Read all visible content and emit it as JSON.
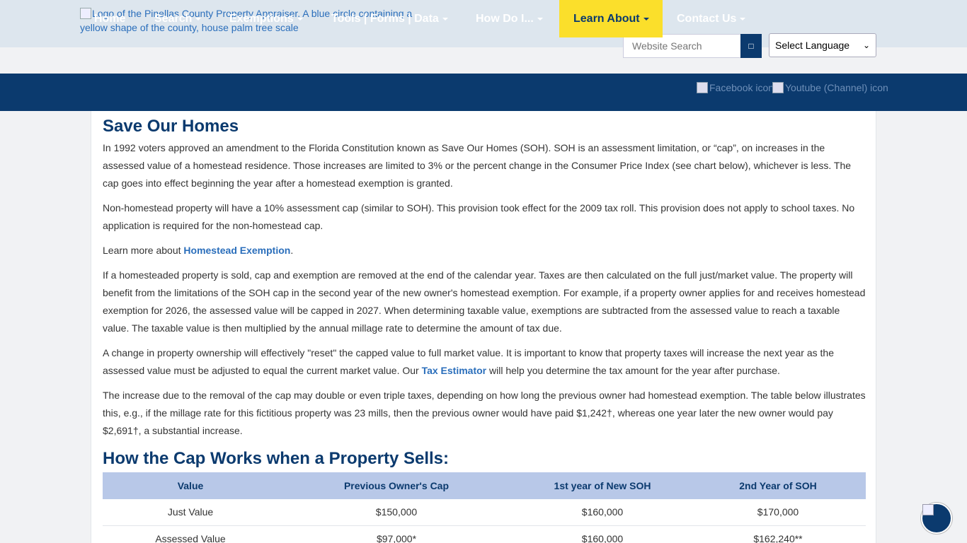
{
  "header": {
    "logo_alt": "Logo of the Pinellas County Property Appraiser. A blue circle containing a yellow shape of the county, house palm tree scale",
    "search_placeholder": "Website Search",
    "language_select": "Select Language"
  },
  "nav": {
    "items": [
      {
        "label": "Home",
        "dropdown": false
      },
      {
        "label": "Search",
        "dropdown": true
      },
      {
        "label": "Exemptions",
        "dropdown": true
      },
      {
        "label": "Tools | Forms | Data",
        "dropdown": true
      },
      {
        "label": "How Do I...",
        "dropdown": true
      },
      {
        "label": "Learn About",
        "dropdown": true,
        "active": true
      },
      {
        "label": "Contact Us",
        "dropdown": true
      }
    ],
    "facebook_alt": "Facebook icon",
    "youtube_alt": "Youtube (Channel) icon"
  },
  "main": {
    "title": "Save Our Homes",
    "p1": "In 1992 voters approved an amendment to the Florida Constitution known as Save Our Homes (SOH). SOH is an assessment limitation, or “cap”, on increases in the assessed value of a homestead residence. Those increases are limited to 3% or the percent change in the Consumer Price Index (see chart below), whichever is less. The cap goes into effect beginning the year after a homestead exemption is granted.",
    "p2": "Non-homestead property will have a 10% assessment cap (similar to SOH). This provision took effect for the 2009 tax roll. This provision does not apply to school taxes. No application is required for the non-homestead cap.",
    "p3_prefix": "Learn more about ",
    "p3_link": "Homestead Exemption",
    "p3_suffix": ".",
    "p4": "If a homesteaded property is sold, cap and exemption are removed at the end of the calendar year. Taxes are then calculated on the full just/market value. The property will benefit from the limitations of the SOH cap in the second year of the new owner's homestead exemption. For example, if a property owner applies for and receives homestead exemption for 2026, the assessed value will be capped in 2027. When determining taxable value, exemptions are subtracted from the assessed value to reach a taxable value. The taxable value is then multiplied by the annual millage rate to determine the amount of tax due.",
    "p5_prefix": "A change in property ownership will effectively \"reset\" the capped value to full market value. It is important to know that property taxes will increase the next year as the assessed value must be adjusted to equal the current market value. Our ",
    "p5_link": "Tax Estimator",
    "p5_suffix": " will help you determine the tax amount for the year after purchase.",
    "p6": "The increase due to the removal of the cap may double or even triple taxes, depending on how long the previous owner had homestead exemption. The table below illustrates this, e.g., if the millage rate for this fictitious property was 23 mills, then the previous owner would have paid $1,242†, whereas one year later the new owner would pay $2,691†, a substantial increase.",
    "subtitle": "How the Cap Works when a Property Sells:"
  },
  "table": {
    "headers": [
      "Value",
      "Previous Owner's Cap",
      "1st year of New SOH",
      "2nd Year of SOH"
    ],
    "rows": [
      [
        "Just Value",
        "$150,000",
        "$160,000",
        "$170,000"
      ],
      [
        "Assessed Value",
        "$97,000*",
        "$160,000",
        "$162,240**"
      ]
    ]
  },
  "colors": {
    "navy": "#0b3a6e",
    "accent_yellow": "#fbdf2b",
    "link": "#2a6ebb",
    "table_header": "#b8c8e8"
  }
}
